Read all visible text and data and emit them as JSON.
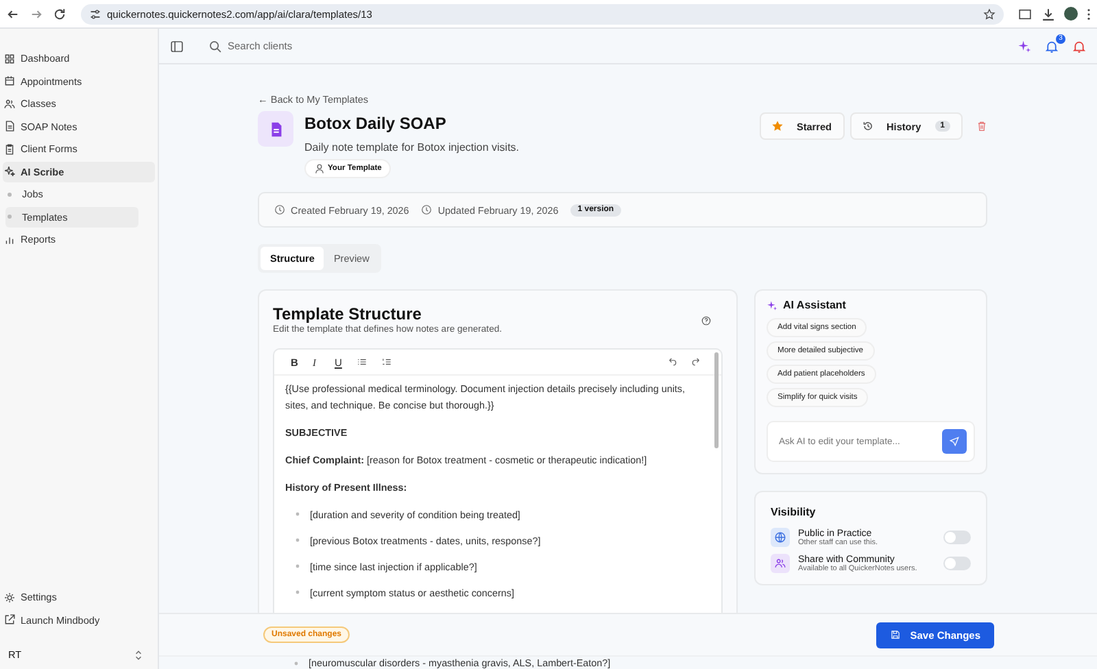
{
  "browser": {
    "url": "quickernotes.quickernotes2.com/app/ai/clara/templates/13"
  },
  "sidebar": {
    "items": [
      {
        "label": "Dashboard",
        "selected": false
      },
      {
        "label": "Appointments",
        "selected": false
      },
      {
        "label": "Classes",
        "selected": false
      },
      {
        "label": "SOAP Notes",
        "selected": false
      },
      {
        "label": "Client Forms",
        "selected": false
      },
      {
        "label": "AI Scribe",
        "selected": true,
        "children": [
          {
            "label": "Jobs",
            "selected": false
          },
          {
            "label": "Templates",
            "selected": true
          }
        ]
      },
      {
        "label": "Reports",
        "selected": false
      }
    ],
    "bottom_items": [
      {
        "label": "Settings"
      },
      {
        "label": "Launch Mindbody"
      }
    ],
    "user": {
      "initials": "RT"
    }
  },
  "topbar": {
    "search": {
      "placeholder": "Search clients"
    },
    "notification_count": "3"
  },
  "header": {
    "back_link": "← Back to My Templates",
    "title": "Botox Daily SOAP",
    "description": "Daily note template for Botox injection visits.",
    "badge": "Your Template",
    "starred": {
      "label": "Starred",
      "on": true
    },
    "history": {
      "label": "History",
      "count": "1"
    }
  },
  "meta": {
    "created": "Created February 19, 2026",
    "updated": "Updated February 19, 2026",
    "versions": "1 version"
  },
  "tabs": [
    {
      "label": "Structure",
      "selected": true
    },
    {
      "label": "Preview",
      "selected": false
    }
  ],
  "structure": {
    "title": "Template Structure",
    "subtitle": "Edit the template that defines how notes are generated.",
    "toolbar": [
      "B",
      "I",
      "U"
    ],
    "content": [
      {
        "kind": "paragraph",
        "text": "{{Use professional medical terminology. Document injection details precisely including units, sites, and technique. Be concise but thorough.}}"
      },
      {
        "kind": "heading",
        "text": "SUBJECTIVE"
      },
      {
        "kind": "paragraph",
        "text": "**Chief Complaint:** [reason for Botox treatment - cosmetic or therapeutic indication!]"
      },
      {
        "kind": "heading",
        "text": "History of Present Illness:"
      },
      {
        "kind": "bullet",
        "text": "[duration and severity of condition being treated]"
      },
      {
        "kind": "bullet",
        "text": "[previous Botox treatments - dates, units, response?]"
      },
      {
        "kind": "bullet",
        "text": "[time since last injection if applicable?]"
      },
      {
        "kind": "bullet",
        "text": "[current symptom status or aesthetic concerns]"
      },
      {
        "kind": "bullet",
        "text": "[neuromuscular disorders - myasthenia gravis, ALS, Lambert-Eaton?]"
      }
    ]
  },
  "ai_assistant": {
    "title": "AI Assistant",
    "suggestions": [
      "Add vital signs section",
      "More detailed subjective",
      "Add patient placeholders",
      "Simplify for quick visits"
    ],
    "input": {
      "placeholder": "Ask AI to edit your template..."
    }
  },
  "visibility": {
    "title": "Visibility",
    "options": [
      {
        "label": "Public in Practice",
        "description": "Other staff can use this.",
        "on": false
      },
      {
        "label": "Share with Community",
        "description": "Available to all QuickerNotes users.",
        "on": false
      }
    ]
  },
  "footer": {
    "status": "Unsaved changes",
    "save": "Save Changes"
  }
}
